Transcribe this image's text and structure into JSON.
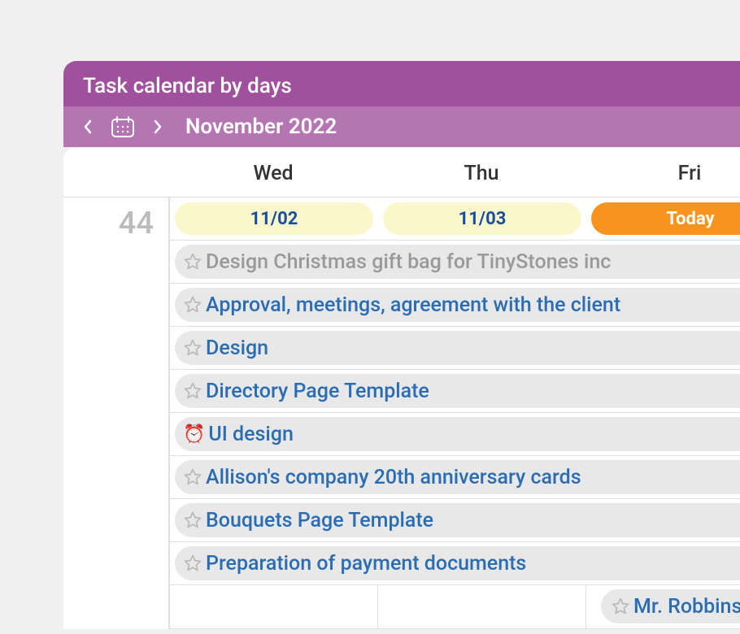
{
  "header": {
    "title": "Task calendar by days",
    "month": "November 2022"
  },
  "day_headers": [
    "Wed",
    "Thu",
    "Fri"
  ],
  "week_number": "44",
  "dates": [
    {
      "label": "11/02",
      "today": false
    },
    {
      "label": "11/03",
      "today": false
    },
    {
      "label": "Today",
      "today": true
    }
  ],
  "tasks": [
    {
      "title": "Design Christmas gift bag for TinyStones inc",
      "muted": true,
      "icon": "star",
      "offset": false
    },
    {
      "title": "Approval, meetings, agreement with the client",
      "muted": false,
      "icon": "star",
      "offset": false
    },
    {
      "title": "Design",
      "muted": false,
      "icon": "star",
      "offset": false
    },
    {
      "title": "Directory Page Template",
      "muted": false,
      "icon": "star",
      "offset": false
    },
    {
      "title": "UI design",
      "muted": false,
      "icon": "clock",
      "offset": false
    },
    {
      "title": "Allison's company 20th anniversary cards",
      "muted": false,
      "icon": "star",
      "offset": false
    },
    {
      "title": "Bouquets Page Template",
      "muted": false,
      "icon": "star",
      "offset": false
    },
    {
      "title": "Preparation of payment documents",
      "muted": false,
      "icon": "star",
      "offset": false
    }
  ],
  "bottom_task": {
    "title": "Mr. Robbins",
    "icon": "star"
  },
  "icons": {
    "clock": "⏰"
  }
}
